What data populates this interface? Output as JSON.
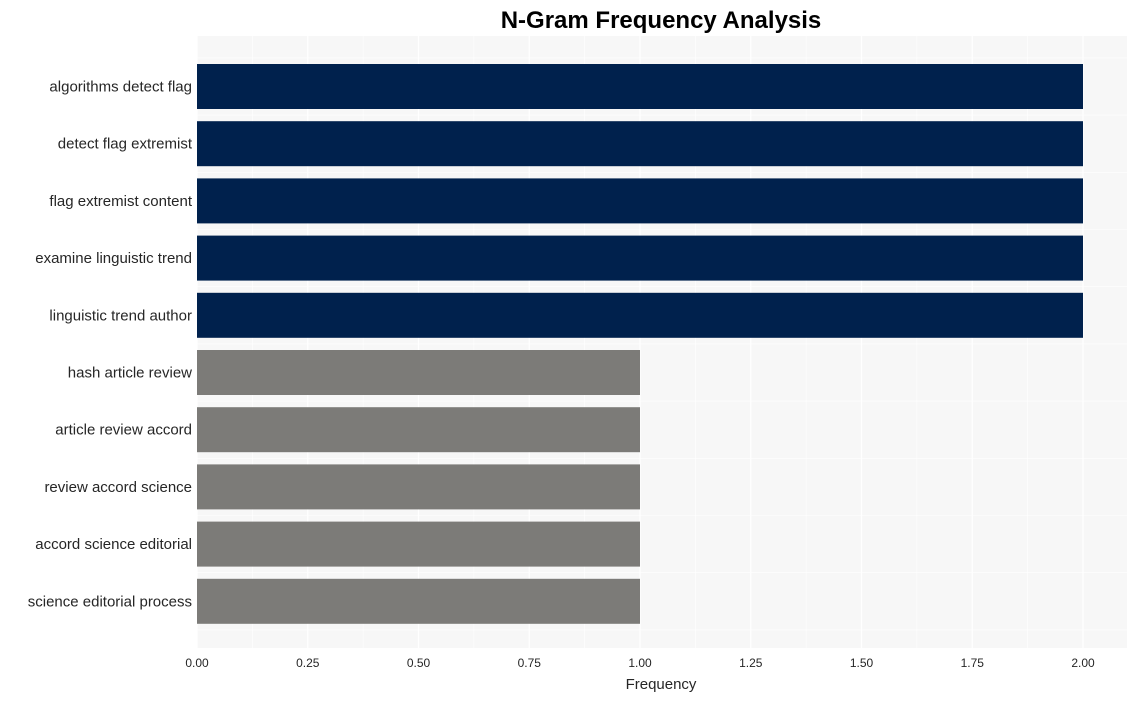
{
  "chart_data": {
    "type": "bar",
    "orientation": "horizontal",
    "title": "N-Gram Frequency Analysis",
    "xlabel": "Frequency",
    "ylabel": "",
    "xlim": [
      0,
      2.1
    ],
    "xticks": [
      "0.00",
      "0.25",
      "0.50",
      "0.75",
      "1.00",
      "1.25",
      "1.50",
      "1.75",
      "2.00"
    ],
    "xtick_values": [
      0,
      0.25,
      0.5,
      0.75,
      1.0,
      1.25,
      1.5,
      1.75,
      2.0
    ],
    "grid": true,
    "categories": [
      "algorithms detect flag",
      "detect flag extremist",
      "flag extremist content",
      "examine linguistic trend",
      "linguistic trend author",
      "hash article review",
      "article review accord",
      "review accord science",
      "accord science editorial",
      "science editorial process"
    ],
    "values": [
      2,
      2,
      2,
      2,
      2,
      1,
      1,
      1,
      1,
      1
    ],
    "colors": {
      "high": "#00214d",
      "low": "#7c7b78",
      "plot_background": "#f7f7f7",
      "grid": "#ffffff"
    }
  }
}
